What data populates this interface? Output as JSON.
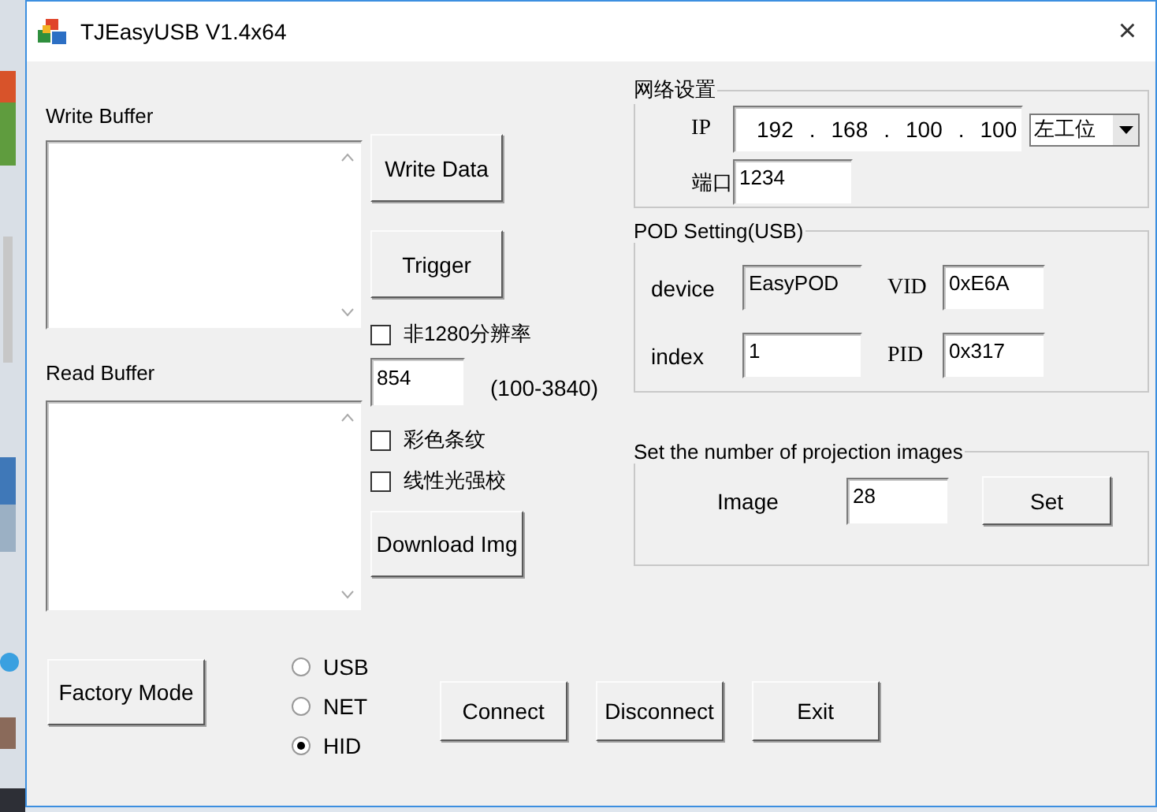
{
  "window": {
    "title": "TJEasyUSB V1.4x64",
    "close": "×"
  },
  "write_buffer": {
    "label": "Write Buffer"
  },
  "read_buffer": {
    "label": "Read Buffer"
  },
  "middle": [
    {
      "kind": "button",
      "label": "Write Data"
    },
    {
      "kind": "button",
      "label": "Trigger"
    },
    {
      "kind": "checkbox",
      "label": "非1280分辨率",
      "checked": false
    },
    {
      "kind": "number",
      "value": "854",
      "hint": "(100-3840)"
    },
    {
      "kind": "checkbox",
      "label": "彩色条纹",
      "checked": false
    },
    {
      "kind": "checkbox",
      "label": "线性光强校",
      "checked": false
    },
    {
      "kind": "button",
      "label": "Download Img"
    }
  ],
  "network": {
    "title": "网络设置",
    "ip_label": "IP",
    "ip": [
      "192",
      "168",
      "100",
      "100"
    ],
    "separator": ".",
    "station": "左工位",
    "port_label": "端口",
    "port": "1234"
  },
  "pod": {
    "title": "POD Setting(USB)",
    "fields": [
      {
        "label": "device",
        "value": "EasyPOD",
        "disabled": true
      },
      {
        "label": "VID",
        "value": "0xE6A",
        "disabled": false
      },
      {
        "label": "index",
        "value": "1",
        "disabled": false
      },
      {
        "label": "PID",
        "value": "0x317",
        "disabled": false
      }
    ]
  },
  "images": {
    "title": "Set the number of projection images",
    "label": "Image",
    "value": "28",
    "button": "Set"
  },
  "factory_button": "Factory Mode",
  "connection": [
    {
      "label": "USB",
      "selected": false
    },
    {
      "label": "NET",
      "selected": false
    },
    {
      "label": "HID",
      "selected": true
    }
  ],
  "actions": [
    "Connect",
    "Disconnect",
    "Exit"
  ]
}
